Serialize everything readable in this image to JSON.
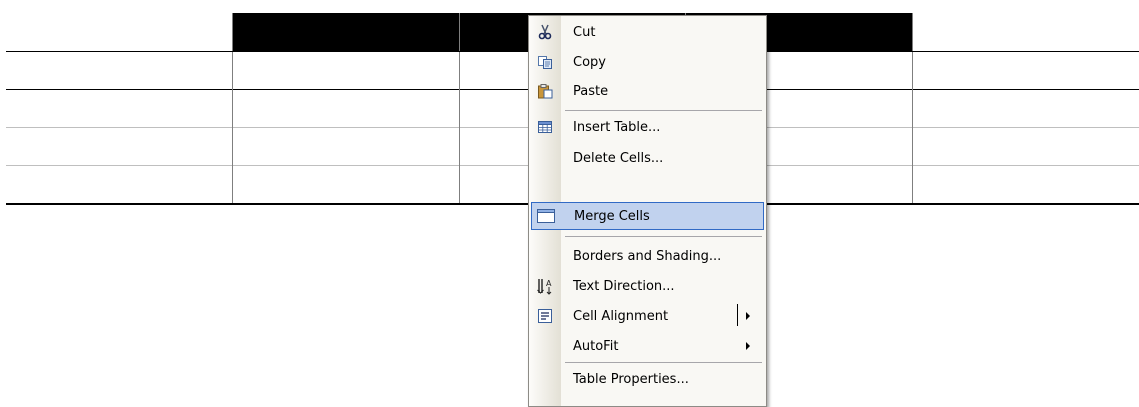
{
  "context_menu": {
    "items": [
      {
        "label": "Cut",
        "icon": "scissors-icon"
      },
      {
        "label": "Copy",
        "icon": "copy-icon"
      },
      {
        "label": "Paste",
        "icon": "paste-icon"
      },
      {
        "label": "Insert Table...",
        "icon": "insert-table-icon"
      },
      {
        "label": "Delete Cells...",
        "icon": ""
      },
      {
        "label": "Merge Cells",
        "icon": "merge-cells-icon",
        "highlighted": true
      },
      {
        "label": "Borders and Shading...",
        "icon": ""
      },
      {
        "label": "Text Direction...",
        "icon": "text-direction-icon"
      },
      {
        "label": "Cell Alignment",
        "icon": "cell-alignment-icon",
        "submenu": true
      },
      {
        "label": "AutoFit",
        "icon": "",
        "submenu": true
      },
      {
        "label": "Table Properties...",
        "icon": ""
      }
    ]
  },
  "colors": {
    "selection": "#000000",
    "hover_bg": "#c1d2ee",
    "hover_border": "#316ac5"
  }
}
